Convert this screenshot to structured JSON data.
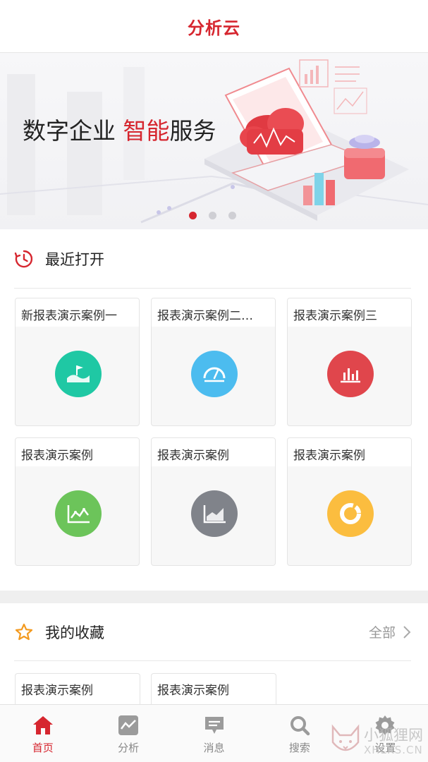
{
  "header": {
    "title": "分析云"
  },
  "banner": {
    "text_before": "数字企业 ",
    "text_highlight": "智能",
    "text_after": "服务",
    "page_count": 3,
    "active_page": 1
  },
  "recent": {
    "title": "最近打开",
    "icon": "clock-icon",
    "tiles": [
      {
        "title": "新报表演示案例一",
        "icon": "wave-flag-icon",
        "color": "#1fc8a4"
      },
      {
        "title": "报表演示案例二…",
        "icon": "gauge-icon",
        "color": "#4cbcef"
      },
      {
        "title": "报表演示案例三",
        "icon": "bar-chart-icon",
        "color": "#e0464c"
      },
      {
        "title": "报表演示案例",
        "icon": "line-chart-icon",
        "color": "#6cc45a"
      },
      {
        "title": "报表演示案例",
        "icon": "area-chart-icon",
        "color": "#80838a"
      },
      {
        "title": "报表演示案例",
        "icon": "donut-chart-icon",
        "color": "#fbbd3f"
      }
    ]
  },
  "favorites": {
    "title": "我的收藏",
    "icon": "star-icon",
    "more_label": "全部",
    "tiles": [
      {
        "title": "报表演示案例"
      },
      {
        "title": "报表演示案例"
      }
    ]
  },
  "tabbar": {
    "tabs": [
      {
        "label": "首页",
        "icon": "home-icon",
        "active": true
      },
      {
        "label": "分析",
        "icon": "analysis-icon",
        "active": false
      },
      {
        "label": "消息",
        "icon": "message-icon",
        "active": false
      },
      {
        "label": "搜索",
        "icon": "search-icon",
        "active": false
      },
      {
        "label": "设置",
        "icon": "gear-icon",
        "active": false
      }
    ]
  },
  "watermark": {
    "line1": "小狐狸网",
    "line2": "XHLKS.CN"
  },
  "colors": {
    "accent": "#d6262f"
  }
}
